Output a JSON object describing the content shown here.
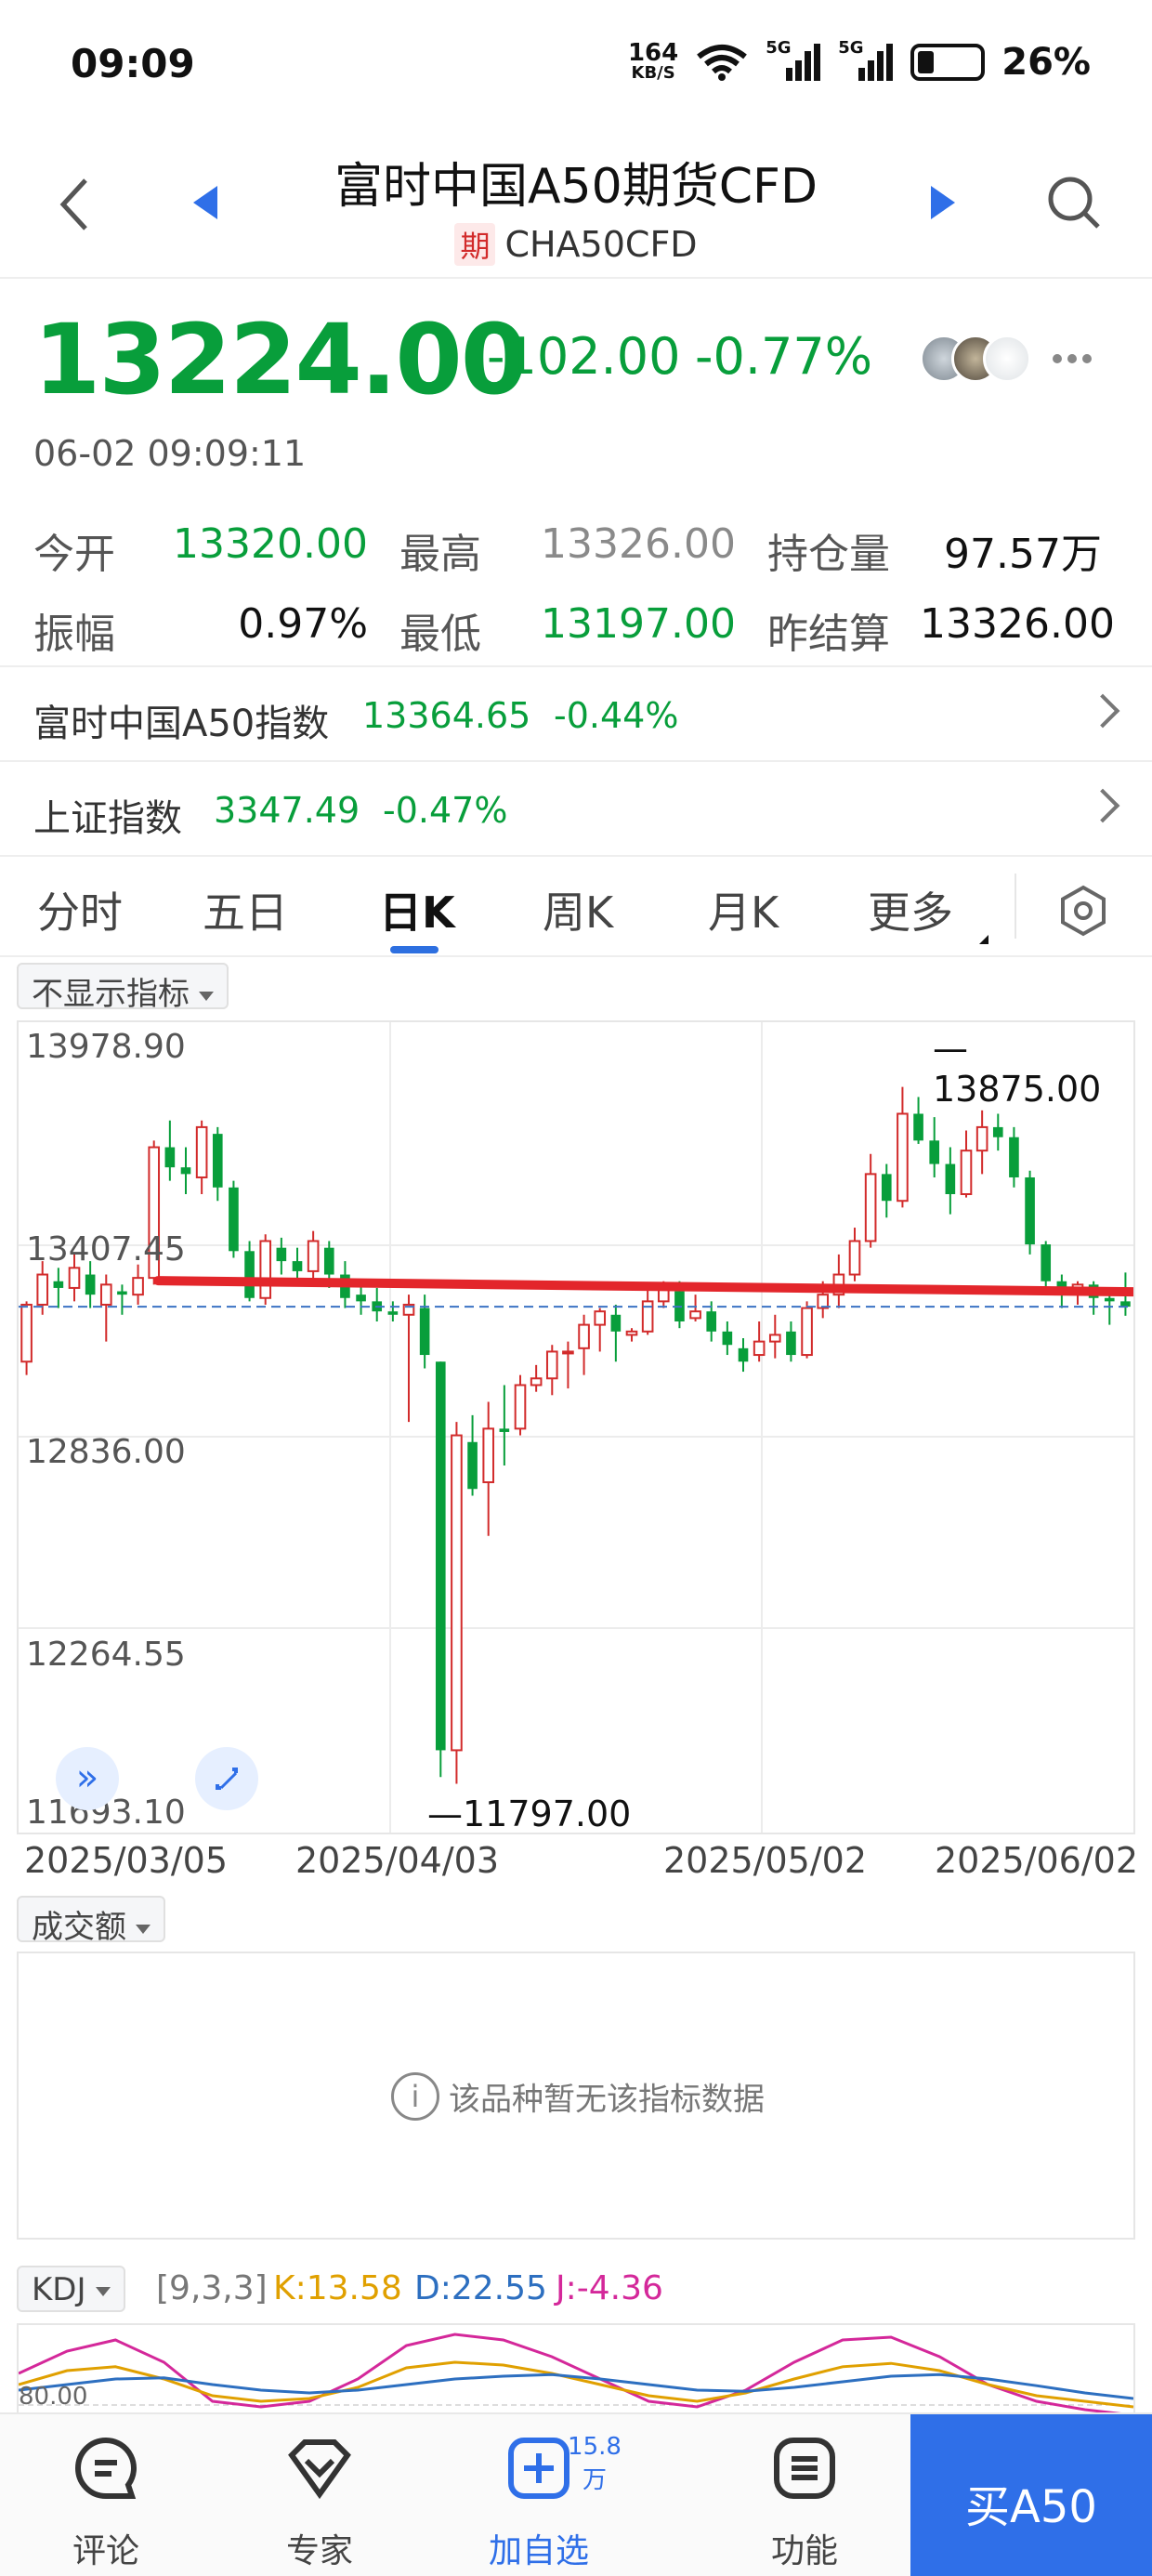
{
  "status_bar": {
    "time": "09:09",
    "net_speed_value": "164",
    "net_speed_unit": "KB/S",
    "signal1": "5G",
    "signal2": "5G",
    "battery": "26%",
    "battery_level": 0.26
  },
  "header": {
    "title": "富时中国A50期货CFD",
    "badge": "期",
    "code": "CHA50CFD"
  },
  "price": {
    "last": "13224.00",
    "change": "-102.00",
    "change_pct": "-0.77%",
    "timestamp": "06-02 09:09:11"
  },
  "stats": [
    {
      "label": "今开",
      "value": "13320.00",
      "color": "green"
    },
    {
      "label": "最高",
      "value": "13326.00",
      "color": "grey"
    },
    {
      "label": "持仓量",
      "value": "97.57万",
      "color": "black"
    },
    {
      "label": "振幅",
      "value": "0.97%",
      "color": "black"
    },
    {
      "label": "最低",
      "value": "13197.00",
      "color": "green"
    },
    {
      "label": "昨结算",
      "value": "13326.00",
      "color": "black"
    }
  ],
  "indexes": [
    {
      "name": "富时中国A50指数",
      "price": "13364.65",
      "pct": "-0.44%"
    },
    {
      "name": "上证指数",
      "price": "3347.49",
      "pct": "-0.47%"
    }
  ],
  "tabs": [
    "分时",
    "五日",
    "日K",
    "周K",
    "月K",
    "更多"
  ],
  "active_tab": "日K",
  "indicator_chip": "不显示指标",
  "volume_chip": "成交额",
  "volume_message": "该品种暂无该指标数据",
  "kdj": {
    "chip": "KDJ",
    "params": "[9,3,3]",
    "k": "K:13.58",
    "d": "D:22.55",
    "j": "J:-4.36",
    "level_label": "80.00"
  },
  "colors": {
    "up": "#d22b2b",
    "down": "#089e3b",
    "accent": "#2f6fe8",
    "k_line": "#e0a000",
    "d_line": "#2d6fc0",
    "j_line": "#d4289a"
  },
  "bottom_bar": {
    "comment": "评论",
    "expert": "专家",
    "add": "加自选",
    "add_count": "15.8万",
    "function": "功能",
    "buy": "买A50"
  },
  "chart_data": {
    "type": "candlestick",
    "y_ticks": [
      "13978.90",
      "13407.45",
      "12836.00",
      "12264.55",
      "11693.10"
    ],
    "ylim": [
      11693.1,
      13978.9
    ],
    "x_ticks": [
      "2025/03/05",
      "2025/04/03",
      "2025/05/02",
      "2025/06/02"
    ],
    "max_label": "13875.00",
    "min_label": "11797.00",
    "last_price_line": 13224.0,
    "candles": [
      [
        13060,
        13230,
        13020,
        13240
      ],
      [
        13230,
        13320,
        13200,
        13360
      ],
      [
        13300,
        13280,
        13220,
        13340
      ],
      [
        13280,
        13340,
        13240,
        13380
      ],
      [
        13320,
        13260,
        13220,
        13360
      ],
      [
        13230,
        13290,
        13120,
        13320
      ],
      [
        13270,
        13260,
        13200,
        13290
      ],
      [
        13260,
        13310,
        13230,
        13350
      ],
      [
        13310,
        13700,
        13290,
        13720
      ],
      [
        13700,
        13640,
        13600,
        13780
      ],
      [
        13640,
        13620,
        13560,
        13700
      ],
      [
        13610,
        13760,
        13560,
        13780
      ],
      [
        13740,
        13580,
        13540,
        13760
      ],
      [
        13580,
        13390,
        13370,
        13600
      ],
      [
        13390,
        13250,
        13240,
        13420
      ],
      [
        13250,
        13420,
        13230,
        13440
      ],
      [
        13400,
        13360,
        13320,
        13430
      ],
      [
        13360,
        13330,
        13300,
        13400
      ],
      [
        13330,
        13420,
        13300,
        13450
      ],
      [
        13400,
        13320,
        13280,
        13420
      ],
      [
        13320,
        13250,
        13220,
        13360
      ],
      [
        13260,
        13240,
        13200,
        13290
      ],
      [
        13240,
        13210,
        13180,
        13280
      ],
      [
        13210,
        13200,
        13180,
        13240
      ],
      [
        13200,
        13230,
        12880,
        13260
      ],
      [
        13220,
        13080,
        13040,
        13260
      ],
      [
        13060,
        11900,
        11820,
        13060
      ],
      [
        11900,
        12840,
        11800,
        12880
      ],
      [
        12820,
        12680,
        12660,
        12900
      ],
      [
        12700,
        12860,
        12540,
        12940
      ],
      [
        12860,
        12850,
        12750,
        12990
      ],
      [
        12860,
        12990,
        12840,
        13020
      ],
      [
        12990,
        13010,
        12970,
        13050
      ],
      [
        13010,
        13090,
        12960,
        13110
      ],
      [
        13090,
        13090,
        12980,
        13120
      ],
      [
        13100,
        13170,
        13020,
        13200
      ],
      [
        13170,
        13210,
        13090,
        13220
      ],
      [
        13200,
        13150,
        13060,
        13230
      ],
      [
        13140,
        13150,
        13120,
        13160
      ],
      [
        13150,
        13240,
        13140,
        13280
      ],
      [
        13240,
        13280,
        13220,
        13300
      ],
      [
        13270,
        13180,
        13160,
        13300
      ],
      [
        13190,
        13210,
        13180,
        13260
      ],
      [
        13210,
        13150,
        13120,
        13240
      ],
      [
        13150,
        13110,
        13080,
        13180
      ],
      [
        13100,
        13060,
        13030,
        13130
      ],
      [
        13080,
        13120,
        13060,
        13180
      ],
      [
        13120,
        13140,
        13070,
        13200
      ],
      [
        13150,
        13080,
        13060,
        13180
      ],
      [
        13080,
        13220,
        13070,
        13240
      ],
      [
        13220,
        13260,
        13190,
        13300
      ],
      [
        13260,
        13320,
        13220,
        13380
      ],
      [
        13320,
        13420,
        13300,
        13460
      ],
      [
        13420,
        13620,
        13400,
        13680
      ],
      [
        13620,
        13540,
        13490,
        13650
      ],
      [
        13540,
        13800,
        13520,
        13880
      ],
      [
        13800,
        13720,
        13710,
        13850
      ],
      [
        13720,
        13650,
        13610,
        13790
      ],
      [
        13650,
        13560,
        13500,
        13700
      ],
      [
        13560,
        13690,
        13550,
        13750
      ],
      [
        13690,
        13760,
        13620,
        13810
      ],
      [
        13760,
        13730,
        13690,
        13800
      ],
      [
        13730,
        13610,
        13580,
        13760
      ],
      [
        13610,
        13410,
        13380,
        13630
      ],
      [
        13410,
        13300,
        13280,
        13420
      ],
      [
        13300,
        13280,
        13220,
        13320
      ],
      [
        13280,
        13290,
        13230,
        13300
      ],
      [
        13290,
        13250,
        13200,
        13300
      ],
      [
        13250,
        13240,
        13170,
        13280
      ],
      [
        13240,
        13224,
        13197,
        13326
      ]
    ],
    "kdj_k": [
      60,
      85,
      92,
      70,
      40,
      30,
      35,
      55,
      90,
      100,
      95,
      80,
      60,
      40,
      30,
      45,
      70,
      92,
      98,
      85,
      60,
      40,
      30,
      20
    ],
    "kdj_d": [
      50,
      60,
      70,
      72,
      60,
      50,
      45,
      50,
      60,
      70,
      75,
      78,
      70,
      60,
      50,
      48,
      55,
      65,
      75,
      78,
      70,
      58,
      45,
      35
    ],
    "kdj_j": [
      80,
      120,
      140,
      100,
      30,
      20,
      30,
      70,
      130,
      150,
      140,
      110,
      70,
      30,
      20,
      50,
      100,
      140,
      145,
      110,
      60,
      30,
      15,
      5
    ]
  }
}
